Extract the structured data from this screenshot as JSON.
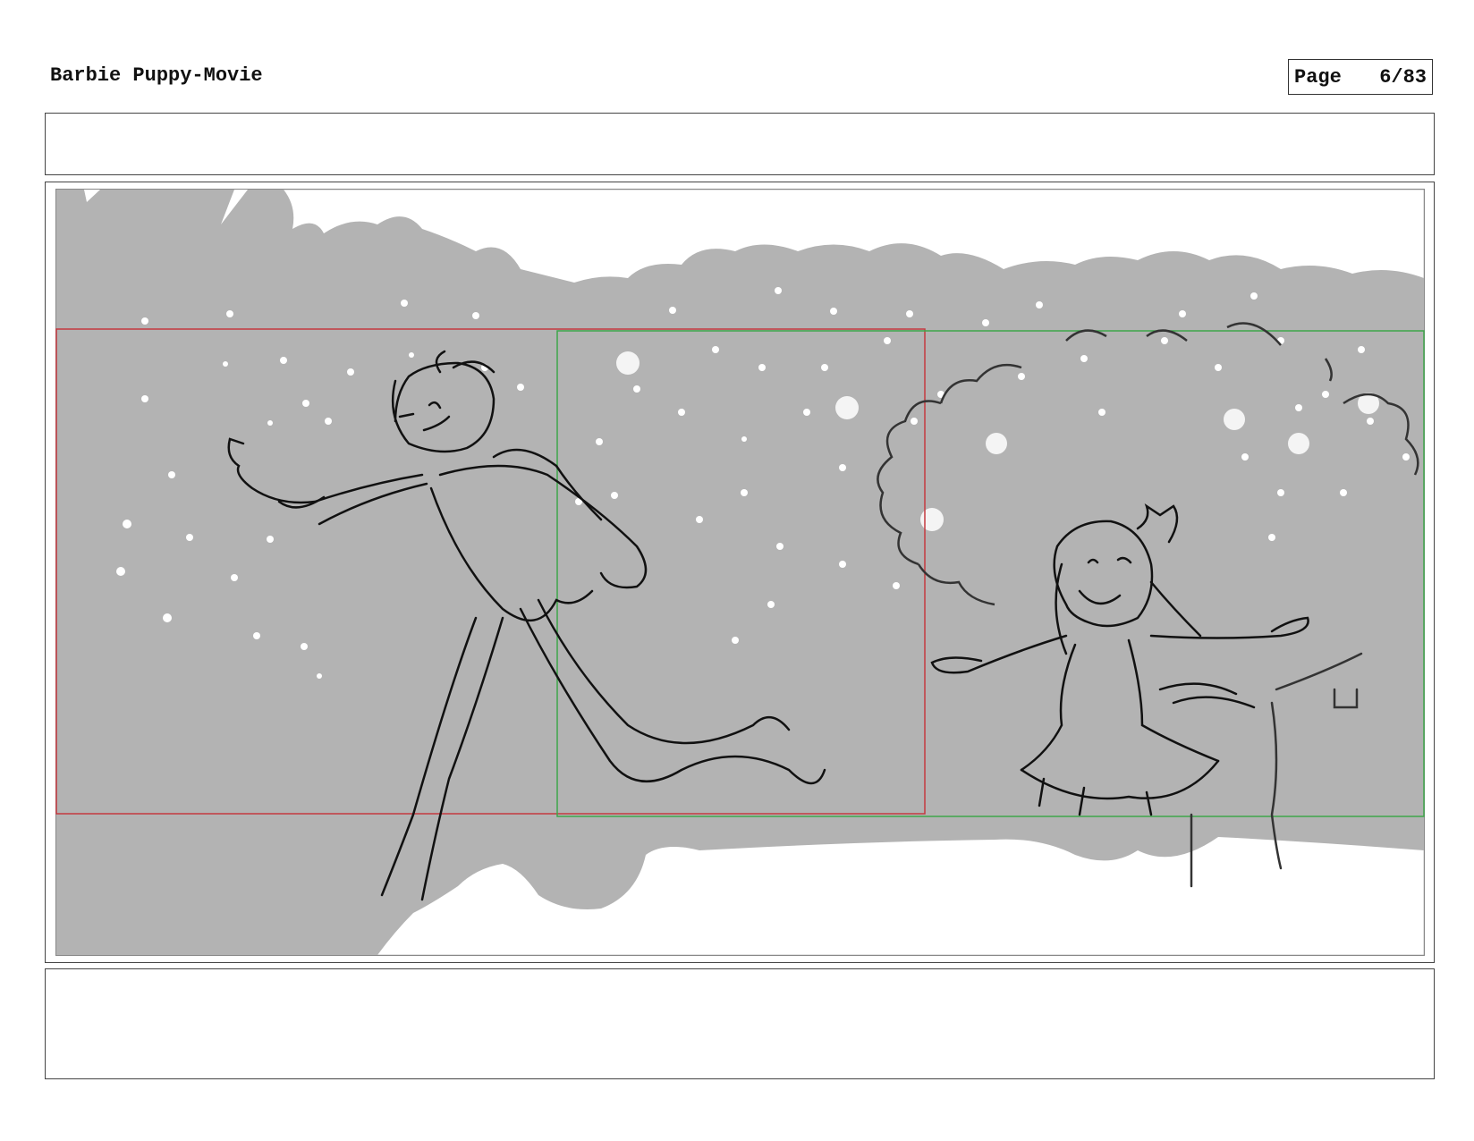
{
  "header": {
    "title": "Barbie Puppy-Movie",
    "page_label": "Page",
    "page_number": "6/83"
  },
  "colors": {
    "background_gray": "#b3b3b3",
    "frame_red": "#c4393f",
    "frame_green": "#3ea64a",
    "ink": "#111111"
  }
}
